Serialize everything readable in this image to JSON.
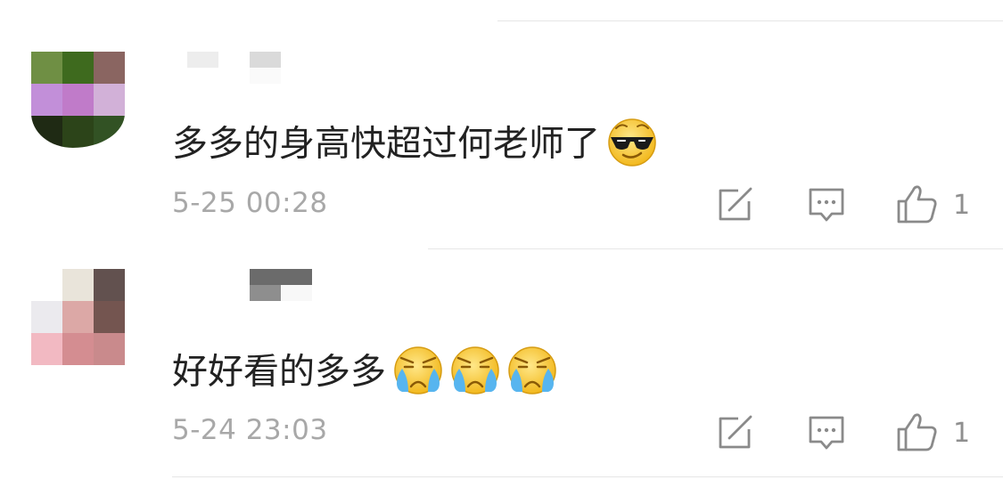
{
  "comments": [
    {
      "avatar_colors": [
        "#6f8f44",
        "#3e6a1e",
        "#8a6561",
        "#c28fd9",
        "#c07bc9",
        "#d2b1d8",
        "#1f2a14",
        "#2c4419",
        "#325224"
      ],
      "username_colors": [
        "#ededed",
        "#ffffff",
        "#dadada",
        "#ffffff",
        "#ffffff",
        "#fafafa"
      ],
      "text": "多多的身高快超过何老师了",
      "emojis": [
        "sunglasses-emoji"
      ],
      "timestamp": "5-25 00:28",
      "like_count": "1"
    },
    {
      "avatar_colors": [
        "#ffffff",
        "#e9e4da",
        "#62514f",
        "#ebeaee",
        "#dca8a6",
        "#745550",
        "#f2b9c2",
        "#d48d91",
        "#c98a8c"
      ],
      "username_colors": [
        "#ffffff",
        "#6b6b6b",
        "#6b6b6b",
        "#ffffff",
        "#8e8e8e",
        "#f8f8f8"
      ],
      "text": "好好看的多多",
      "emojis": [
        "crying-emoji",
        "crying-emoji",
        "crying-emoji"
      ],
      "timestamp": "5-24 23:03",
      "like_count": "1"
    }
  ]
}
